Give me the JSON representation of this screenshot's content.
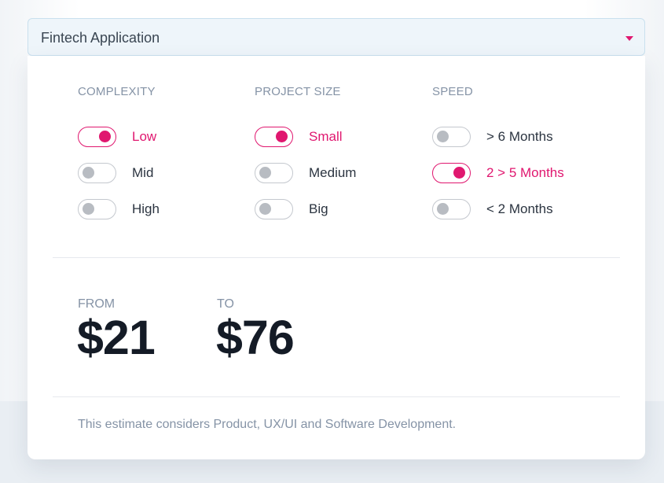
{
  "select": {
    "value": "Fintech Application",
    "caret_icon": "caret-down"
  },
  "filters": {
    "complexity": {
      "title": "COMPLEXITY",
      "options": [
        {
          "label": "Low",
          "on": true
        },
        {
          "label": "Mid",
          "on": false
        },
        {
          "label": "High",
          "on": false
        }
      ]
    },
    "project_size": {
      "title": "PROJECT SIZE",
      "options": [
        {
          "label": "Small",
          "on": true
        },
        {
          "label": "Medium",
          "on": false
        },
        {
          "label": "Big",
          "on": false
        }
      ]
    },
    "speed": {
      "title": "SPEED",
      "options": [
        {
          "label": "> 6 Months",
          "on": false
        },
        {
          "label": "2 > 5 Months",
          "on": true
        },
        {
          "label": "< 2 Months",
          "on": false
        }
      ]
    }
  },
  "estimate": {
    "from_label": "FROM",
    "from_value": "$21",
    "to_label": "TO",
    "to_value": "$76"
  },
  "note": "This estimate considers Product, UX/UI and Software Development.",
  "colors": {
    "accent": "#e0176f",
    "text_dark": "#141b26",
    "text_muted": "#8593a6",
    "toggle_off": "#b8bcc2",
    "select_bg": "#eef5fa"
  }
}
